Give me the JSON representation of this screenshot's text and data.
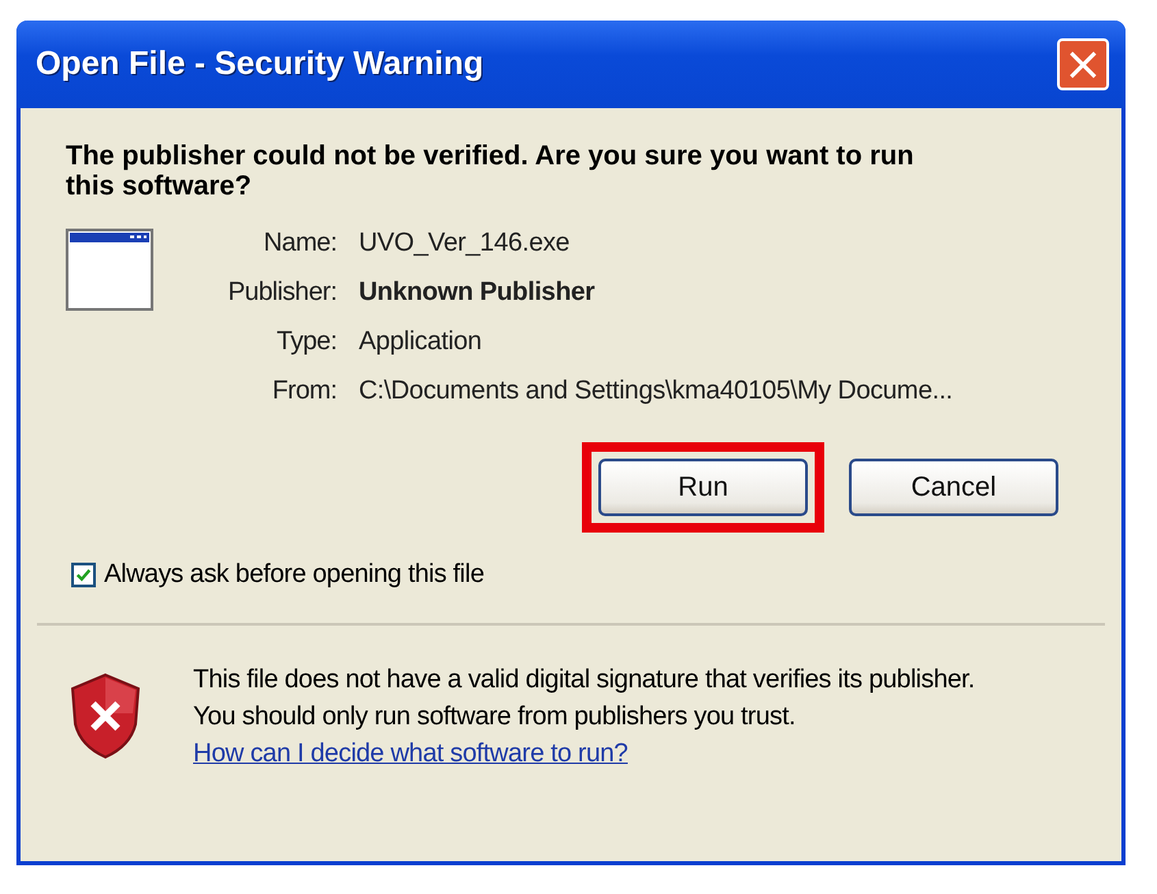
{
  "window": {
    "title": "Open File - Security Warning",
    "close": "×"
  },
  "heading": "The publisher could not be verified.  Are you sure you want to run this software?",
  "details": [
    {
      "label": "Name:",
      "value": "UVO_Ver_146.exe",
      "bold": false
    },
    {
      "label": "Publisher:",
      "value": "Unknown Publisher",
      "bold": true
    },
    {
      "label": "Type:",
      "value": "Application",
      "bold": false
    },
    {
      "label": "From:",
      "value": "C:\\Documents and Settings\\kma40105\\My Docume...",
      "bold": false
    }
  ],
  "buttons": [
    {
      "label": "Run",
      "highlighted": true
    },
    {
      "label": "Cancel",
      "highlighted": false
    }
  ],
  "checkbox": {
    "label": "Always ask before opening this file",
    "checked": true
  },
  "footer": {
    "text": "This file does not have a valid digital signature that verifies its publisher.  You should only run software from publishers you trust.",
    "link": "How can I decide what software to run?"
  }
}
